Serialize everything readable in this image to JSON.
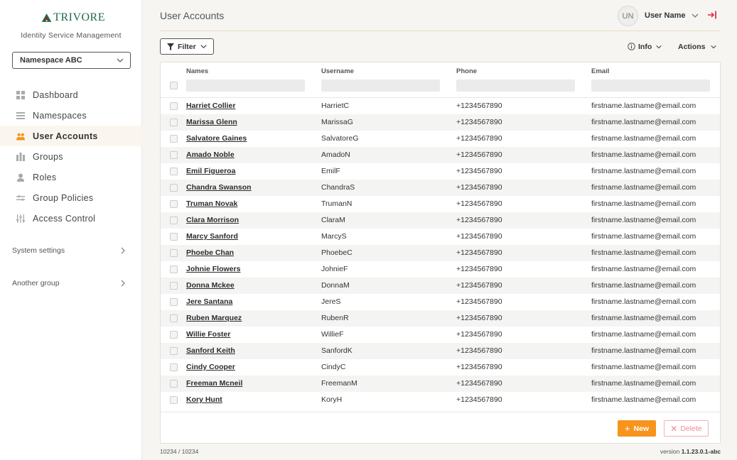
{
  "sidebar": {
    "logo_text": "TRIVORE",
    "subtitle": "Identity Service Management",
    "namespace": "Namespace ABC",
    "nav": [
      {
        "label": "Dashboard",
        "icon": "grid-icon"
      },
      {
        "label": "Namespaces",
        "icon": "list-icon"
      },
      {
        "label": "User Accounts",
        "icon": "users-icon"
      },
      {
        "label": "Groups",
        "icon": "groups-icon"
      },
      {
        "label": "Roles",
        "icon": "person-icon"
      },
      {
        "label": "Group Policies",
        "icon": "policy-icon"
      },
      {
        "label": "Access Control",
        "icon": "sliders-icon"
      }
    ],
    "active_index": 2,
    "groups": [
      "System settings",
      "Another group"
    ]
  },
  "header": {
    "title": "User Accounts",
    "avatar_initials": "UN",
    "user_name": "User Name"
  },
  "toolbar": {
    "filter_label": "Filter",
    "info_label": "Info",
    "actions_label": "Actions"
  },
  "table": {
    "columns": [
      "Names",
      "Username",
      "Phone",
      "Email"
    ],
    "rows": [
      {
        "name": "Harriet Collier",
        "username": "HarrietC",
        "phone": "+1234567890",
        "email": "firstname.lastname@email.com"
      },
      {
        "name": "Marissa Glenn",
        "username": "MarissaG",
        "phone": "+1234567890",
        "email": "firstname.lastname@email.com"
      },
      {
        "name": "Salvatore Gaines",
        "username": "SalvatoreG",
        "phone": "+1234567890",
        "email": "firstname.lastname@email.com"
      },
      {
        "name": "Amado Noble",
        "username": "AmadoN",
        "phone": "+1234567890",
        "email": "firstname.lastname@email.com"
      },
      {
        "name": "Emil Figueroa",
        "username": "EmilF",
        "phone": "+1234567890",
        "email": "firstname.lastname@email.com"
      },
      {
        "name": "Chandra Swanson",
        "username": "ChandraS",
        "phone": "+1234567890",
        "email": "firstname.lastname@email.com"
      },
      {
        "name": "Truman Novak",
        "username": "TrumanN",
        "phone": "+1234567890",
        "email": "firstname.lastname@email.com"
      },
      {
        "name": "Clara Morrison",
        "username": "ClaraM",
        "phone": "+1234567890",
        "email": "firstname.lastname@email.com"
      },
      {
        "name": "Marcy Sanford",
        "username": "MarcyS",
        "phone": "+1234567890",
        "email": "firstname.lastname@email.com"
      },
      {
        "name": "Phoebe Chan",
        "username": "PhoebeC",
        "phone": "+1234567890",
        "email": "firstname.lastname@email.com"
      },
      {
        "name": "Johnie Flowers",
        "username": "JohnieF",
        "phone": "+1234567890",
        "email": "firstname.lastname@email.com"
      },
      {
        "name": "Donna Mckee",
        "username": "DonnaM",
        "phone": "+1234567890",
        "email": "firstname.lastname@email.com"
      },
      {
        "name": "Jere Santana",
        "username": "JereS",
        "phone": "+1234567890",
        "email": "firstname.lastname@email.com"
      },
      {
        "name": "Ruben Marquez",
        "username": "RubenR",
        "phone": "+1234567890",
        "email": "firstname.lastname@email.com"
      },
      {
        "name": "Willie Foster",
        "username": "WillieF",
        "phone": "+1234567890",
        "email": "firstname.lastname@email.com"
      },
      {
        "name": "Sanford Keith",
        "username": "SanfordK",
        "phone": "+1234567890",
        "email": "firstname.lastname@email.com"
      },
      {
        "name": "Cindy Cooper",
        "username": "CindyC",
        "phone": "+1234567890",
        "email": "firstname.lastname@email.com"
      },
      {
        "name": "Freeman Mcneil",
        "username": "FreemanM",
        "phone": "+1234567890",
        "email": "firstname.lastname@email.com"
      },
      {
        "name": "Kory Hunt",
        "username": "KoryH",
        "phone": "+1234567890",
        "email": "firstname.lastname@email.com"
      }
    ],
    "new_label": "New",
    "delete_label": "Delete"
  },
  "footer": {
    "count": "10234 / 10234",
    "version_prefix": "version",
    "version": "1.1.23.0.1-abc"
  },
  "colors": {
    "accent": "#f7941d",
    "brand_green": "#1f6b46",
    "brand_red": "#c8102e",
    "delete_border": "#f2b0b8",
    "logout": "#e0304e"
  }
}
